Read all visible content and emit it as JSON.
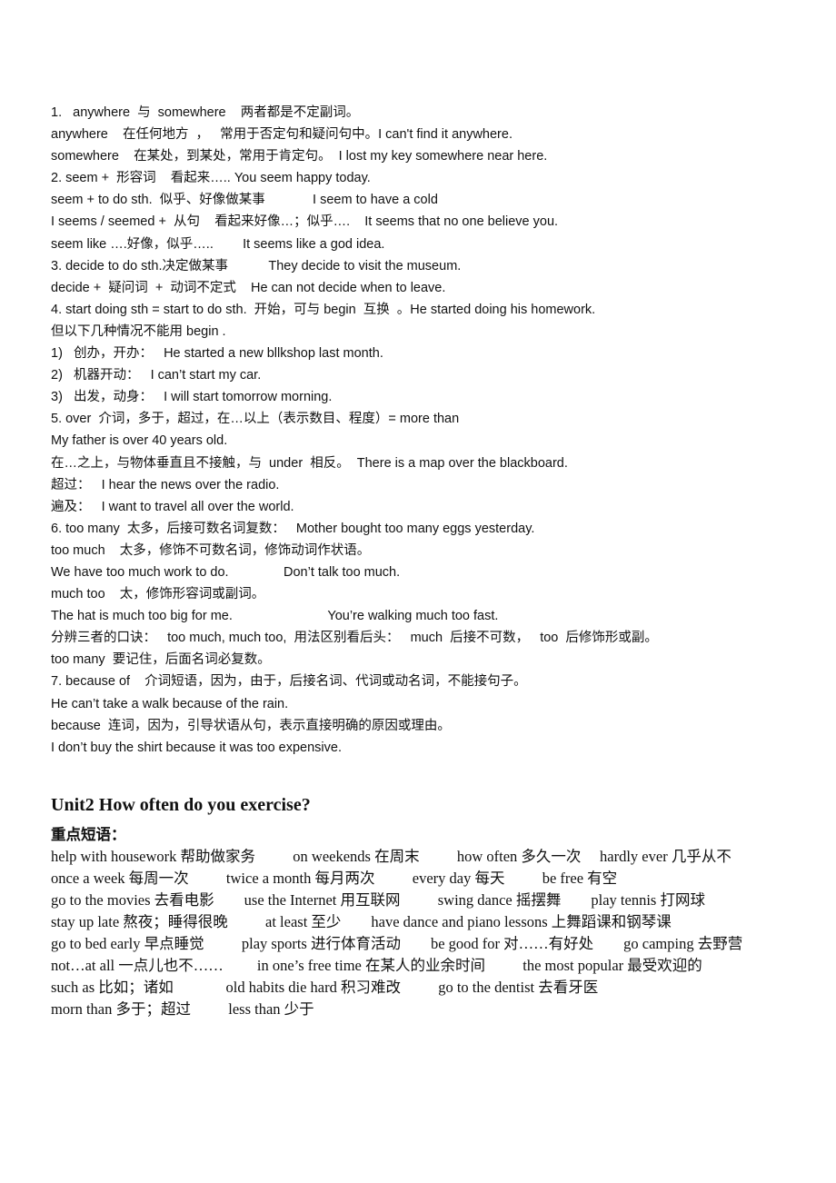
{
  "section1": {
    "lines": [
      "1.   anywhere  与  somewhere    两者都是不定副词。",
      "anywhere    在任何地方  ，   常用于否定句和疑问句中。I can't find it anywhere.",
      "somewhere    在某处，到某处，常用于肯定句。  I lost my key somewhere near here.",
      "2. seem +  形容词    看起来….. You seem happy today.",
      "seem + to do sth.  似乎、好像做某事             I seem to have a cold",
      "I seems / seemed +  从句    看起来好像…；似乎….    It seems that no one believe you.",
      "seem like ….好像，似乎…..        It seems like a god idea.",
      "3. decide to do sth.决定做某事           They decide to visit the museum.",
      "decide +  疑问词  +  动词不定式    He can not decide when to leave.",
      "4. start doing sth = start to do sth.  开始，可与 begin  互换  。He started doing his homework.",
      "但以下几种情况不能用 begin .",
      "1)   创办，开办：   He started a new bllkshop last month.",
      "2)   机器开动：   I can’t start my car.",
      "3)   出发，动身：   I will start tomorrow morning.",
      "5. over  介词，多于，超过，在…以上（表示数目、程度）= more than",
      "My father is over 40 years old.",
      "在…之上，与物体垂直且不接触，与  under  相反。  There is a map over the blackboard.",
      "超过：   I hear the news over the radio.",
      "遍及：   I want to travel all over the world.",
      "6. too many  太多，后接可数名词复数：   Mother bought too many eggs yesterday.",
      "too much    太多，修饰不可数名词，修饰动词作状语。",
      "We have too much work to do.               Don’t talk too much.",
      "much too    太，修饰形容词或副词。",
      "The hat is much too big for me.                          You’re walking much too fast.",
      "分辨三者的口诀：   too much, much too,  用法区别看后头：   much  后接不可数，   too  后修饰形或副。",
      "too many  要记住，后面名词必复数。",
      "7. because of    介词短语，因为，由于，后接名词、代词或动名词，不能接句子。",
      "He can’t take a walk because of the rain.",
      "because  连词，因为，引导状语从句，表示直接明确的原因或理由。",
      "I don’t buy the shirt because it was too expensive."
    ]
  },
  "section2": {
    "title": "Unit2 How often do you exercise?",
    "subtitle": "重点短语：",
    "lines": [
      "help with housework 帮助做家务          on weekends 在周末          how often 多久一次     hardly ever 几乎从不",
      "once a week 每周一次          twice a month 每月两次          every day 每天          be free 有空",
      "go to the movies 去看电影        use the Internet 用互联网          swing dance 摇摆舞        play tennis 打网球",
      "stay up late 熬夜；睡得很晚          at least 至少        have dance and piano lessons 上舞蹈课和钢琴课",
      "go to bed early 早点睡觉          play sports 进行体育活动        be good for 对……有好处        go camping 去野营",
      "not…at all 一点儿也不……         in one’s free time 在某人的业余时间          the most popular 最受欢迎的",
      "such as 比如；诸如              old habits die hard 积习难改          go to the dentist 去看牙医",
      "morn than 多于；超过          less than 少于"
    ]
  }
}
